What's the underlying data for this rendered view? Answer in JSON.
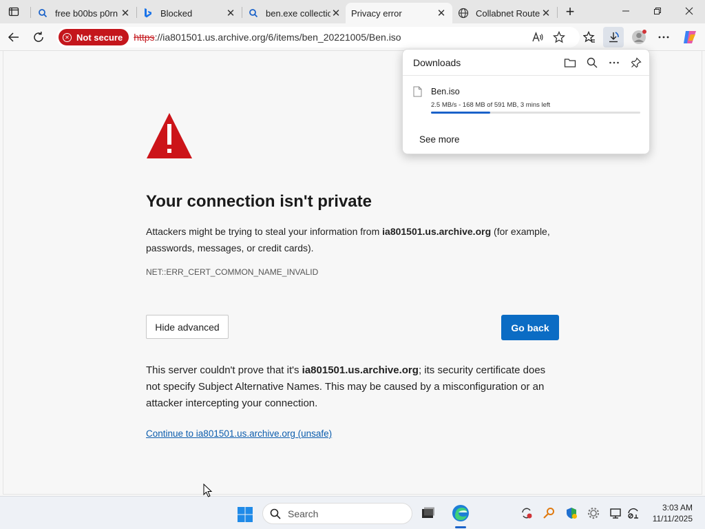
{
  "browser": {
    "tabs": [
      {
        "title": "free b00bs p0rn -",
        "icon": "search-icon",
        "active": false
      },
      {
        "title": "Blocked",
        "icon": "bing-icon",
        "active": false
      },
      {
        "title": "ben.exe collectio",
        "icon": "search-icon",
        "active": false
      },
      {
        "title": "Privacy error",
        "icon": "none",
        "active": true
      },
      {
        "title": "Collabnet Router",
        "icon": "globe-icon",
        "active": false
      }
    ],
    "address": {
      "security_label": "Not secure",
      "url_scheme": "https",
      "url_rest": "://ia801501.us.archive.org/6/items/ben_20221005/Ben.iso"
    }
  },
  "page": {
    "heading": "Your connection isn't private",
    "para_prefix": "Attackers might be trying to steal your information from ",
    "host": "ia801501.us.archive.org",
    "para_suffix": " (for example, passwords, messages, or credit cards).",
    "error_code": "NET::ERR_CERT_COMMON_NAME_INVALID",
    "hide_advanced_label": "Hide advanced",
    "go_back_label": "Go back",
    "adv_prefix": "This server couldn't prove that it's ",
    "adv_suffix": "; its security certificate does not specify Subject Alternative Names. This may be caused by a misconfiguration or an attacker intercepting your connection.",
    "continue_link": "Continue to ia801501.us.archive.org (unsafe)"
  },
  "downloads": {
    "title": "Downloads",
    "filename": "Ben.iso",
    "status": "2.5 MB/s - 168 MB of 591 MB, 3 mins left",
    "progress_percent": 28.4,
    "see_more": "See more"
  },
  "taskbar": {
    "search_placeholder": "Search",
    "time": "3:03 AM",
    "date": "11/11/2025"
  },
  "colors": {
    "accent": "#0b6cc4",
    "danger": "#c4161c",
    "progress": "#1a62c9"
  }
}
